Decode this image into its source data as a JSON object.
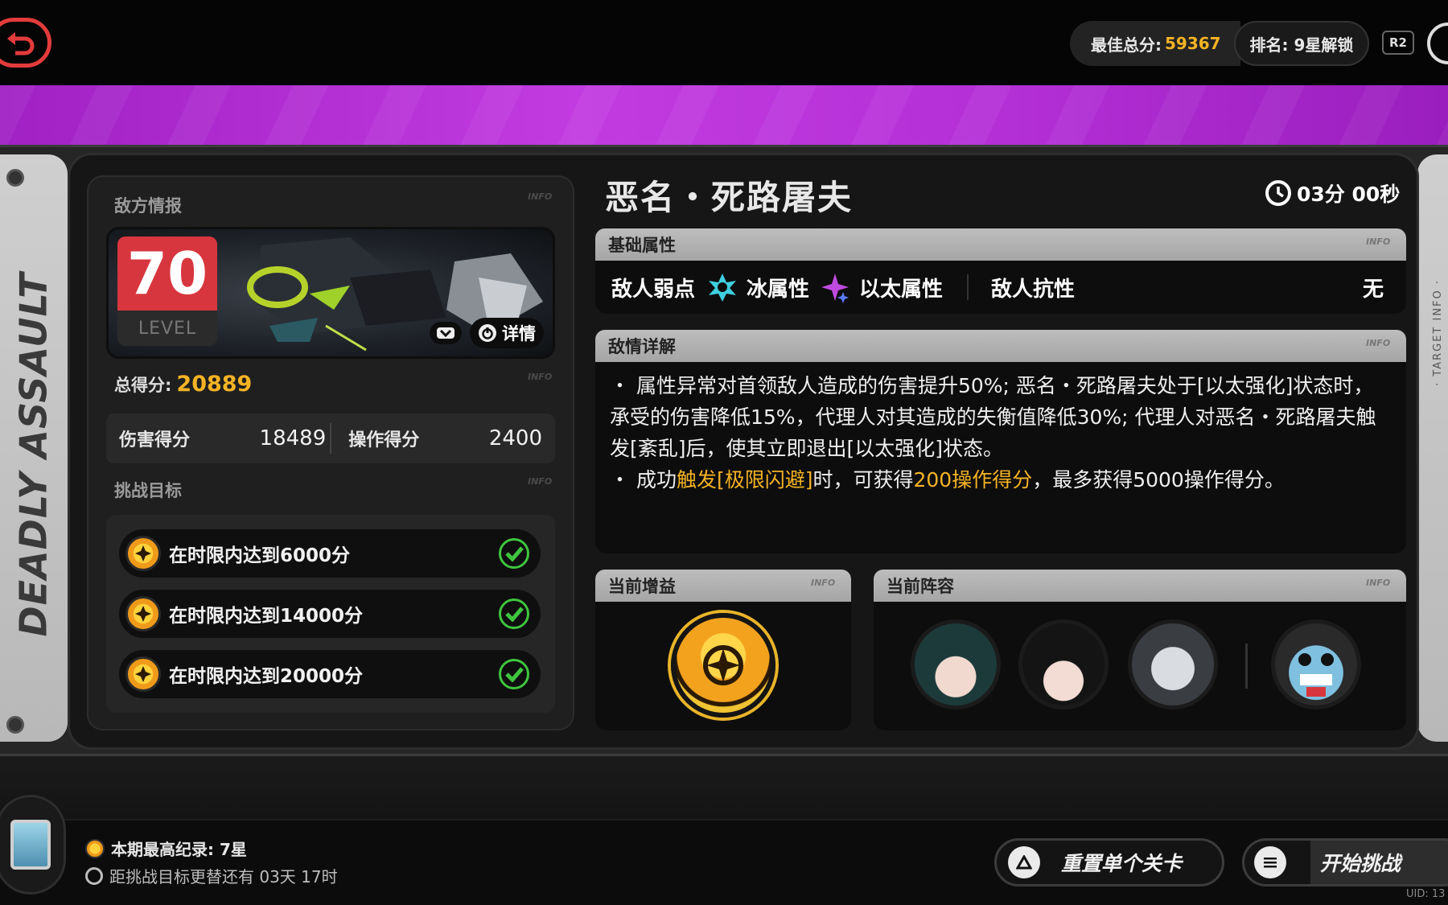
{
  "header": {
    "best_score_label": "最佳总分:",
    "best_score_value": "59367",
    "rank_label": "排名: 9星解锁",
    "r2_label": "R2"
  },
  "side": {
    "left_vertical_text": "DEADLY ASSAULT",
    "right_vertical_text": "· TARGET INFO ·"
  },
  "enemy_info": {
    "section_label": "敌方情报",
    "info_tag": "INFO",
    "level_number": "70",
    "level_label": "LEVEL",
    "detail_button": "详情",
    "total_score_label": "总得分:",
    "total_score_value": "20889",
    "damage_score_label": "伤害得分",
    "damage_score_value": "18489",
    "operation_score_label": "操作得分",
    "operation_score_value": "2400"
  },
  "challenge": {
    "section_label": "挑战目标",
    "goals": [
      {
        "text": "在时限内达到6000分",
        "completed": true
      },
      {
        "text": "在时限内达到14000分",
        "completed": true
      },
      {
        "text": "在时限内达到20000分",
        "completed": true
      }
    ]
  },
  "boss": {
    "title": "恶名・死路屠夫",
    "timer": "03分 00秒"
  },
  "base_attributes": {
    "header": "基础属性",
    "weakness_label": "敌人弱点",
    "weakness_1": "冰属性",
    "weakness_2": "以太属性",
    "resistance_label": "敌人抗性",
    "resistance_value": "无"
  },
  "enemy_detail": {
    "header": "敌情详解",
    "p1": "・ 属性异常对首领敌人造成的伤害提升50%; 恶名・死路屠夫处于[以太强化]状态时，承受的伤害降低15%，代理人对其造成的失衡值降低30%; 代理人对恶名・死路屠夫触发[紊乱]后，使其立即退出[以太强化]状态。",
    "p2_a": "・ 成功",
    "p2_hl1": "触发[极限闪避]",
    "p2_b": "时，可获得",
    "p2_hl2": "200操作得分",
    "p2_c": "，最多获得5000操作得分。"
  },
  "buff": {
    "header": "当前增益"
  },
  "team": {
    "header": "当前阵容"
  },
  "footer": {
    "record": "本期最高纪录: 7星",
    "countdown": "距挑战目标更替还有 03天 17时",
    "reset_button": "重置单个关卡",
    "start_button": "开始挑战",
    "uid": "UID: 13"
  },
  "colors": {
    "accent_gold": "#f5b324",
    "level_red": "#d8363e",
    "check_green": "#3ec63e",
    "band_purple": "#b32fd6"
  }
}
